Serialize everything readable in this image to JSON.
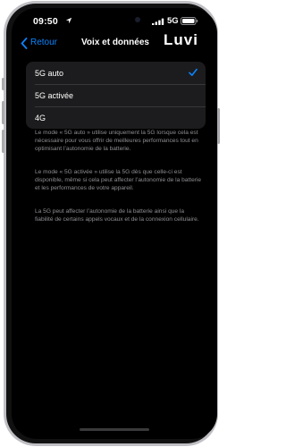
{
  "status_bar": {
    "time": "09:50",
    "network": "5G",
    "icons": [
      "location-arrow-icon",
      "signal-bars-icon",
      "battery-icon"
    ]
  },
  "nav": {
    "back_label": "Retour",
    "title": "Voix et données",
    "brand": "Luvi"
  },
  "options": [
    {
      "label": "5G auto",
      "selected": true
    },
    {
      "label": "5G activée",
      "selected": false
    },
    {
      "label": "4G",
      "selected": false
    }
  ],
  "footers": [
    "Le mode « 5G auto » utilise uniquement la 5G lorsque cela est nécessaire pour vous offrir de meilleures performances tout en optimisant l’autonomie de la batterie.",
    "Le mode « 5G activée » utilise la 5G dès que celle-ci est disponible, même si cela peut affecter l’autonomie de la batterie et les performances de votre appareil.",
    "La 5G peut affecter l’autonomie de la batterie ainsi que la fiabilité de certains appels vocaux et de la connexion cellulaire."
  ],
  "colors": {
    "accent": "#0a84ff",
    "background": "#000000",
    "cell": "#1c1c1e",
    "secondary_text": "#8e8e93"
  }
}
